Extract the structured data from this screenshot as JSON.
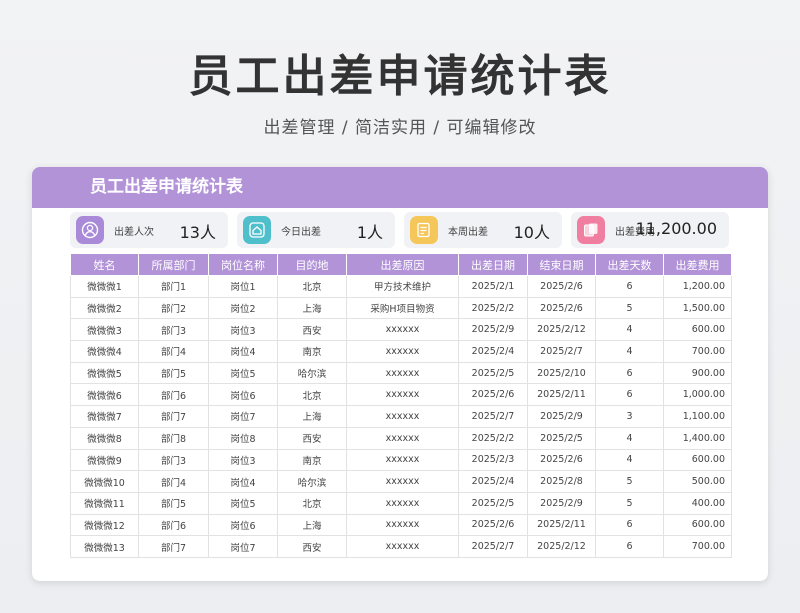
{
  "page": {
    "title": "员工出差申请统计表",
    "subtitle": "出差管理 /  简洁实用  /  可编辑修改"
  },
  "card": {
    "title": "员工出差申请统计表"
  },
  "stats": [
    {
      "label": "出差人次",
      "value": "13人",
      "icon": "person-icon",
      "color": "#a98ad8"
    },
    {
      "label": "今日出差",
      "value": "1人",
      "icon": "home-icon",
      "color": "#4fbfcc"
    },
    {
      "label": "本周出差",
      "value": "10人",
      "icon": "document-icon",
      "color": "#f5c75a"
    },
    {
      "label": "出差费用",
      "value": "11,200.00",
      "icon": "cards-icon",
      "color": "#f07ea0"
    }
  ],
  "table": {
    "columns": [
      "姓名",
      "所属部门",
      "岗位名称",
      "目的地",
      "出差原因",
      "出差日期",
      "结束日期",
      "出差天数",
      "出差费用"
    ],
    "rows": [
      [
        "微微微1",
        "部门1",
        "岗位1",
        "北京",
        "甲方技术维护",
        "2025/2/1",
        "2025/2/6",
        "6",
        "1,200.00"
      ],
      [
        "微微微2",
        "部门2",
        "岗位2",
        "上海",
        "采购H项目物资",
        "2025/2/2",
        "2025/2/6",
        "5",
        "1,500.00"
      ],
      [
        "微微微3",
        "部门3",
        "岗位3",
        "西安",
        "xxxxxx",
        "2025/2/9",
        "2025/2/12",
        "4",
        "600.00"
      ],
      [
        "微微微4",
        "部门4",
        "岗位4",
        "南京",
        "xxxxxx",
        "2025/2/4",
        "2025/2/7",
        "4",
        "700.00"
      ],
      [
        "微微微5",
        "部门5",
        "岗位5",
        "哈尔滨",
        "xxxxxx",
        "2025/2/5",
        "2025/2/10",
        "6",
        "900.00"
      ],
      [
        "微微微6",
        "部门6",
        "岗位6",
        "北京",
        "xxxxxx",
        "2025/2/6",
        "2025/2/11",
        "6",
        "1,000.00"
      ],
      [
        "微微微7",
        "部门7",
        "岗位7",
        "上海",
        "xxxxxx",
        "2025/2/7",
        "2025/2/9",
        "3",
        "1,100.00"
      ],
      [
        "微微微8",
        "部门8",
        "岗位8",
        "西安",
        "xxxxxx",
        "2025/2/2",
        "2025/2/5",
        "4",
        "1,400.00"
      ],
      [
        "微微微9",
        "部门3",
        "岗位3",
        "南京",
        "xxxxxx",
        "2025/2/3",
        "2025/2/6",
        "4",
        "600.00"
      ],
      [
        "微微微10",
        "部门4",
        "岗位4",
        "哈尔滨",
        "xxxxxx",
        "2025/2/4",
        "2025/2/8",
        "5",
        "500.00"
      ],
      [
        "微微微11",
        "部门5",
        "岗位5",
        "北京",
        "xxxxxx",
        "2025/2/5",
        "2025/2/9",
        "5",
        "400.00"
      ],
      [
        "微微微12",
        "部门6",
        "岗位6",
        "上海",
        "xxxxxx",
        "2025/2/6",
        "2025/2/11",
        "6",
        "600.00"
      ],
      [
        "微微微13",
        "部门7",
        "岗位7",
        "西安",
        "xxxxxx",
        "2025/2/7",
        "2025/2/12",
        "6",
        "700.00"
      ]
    ]
  },
  "colors": {
    "accent": "#b293d8",
    "title_text": "#333333"
  }
}
